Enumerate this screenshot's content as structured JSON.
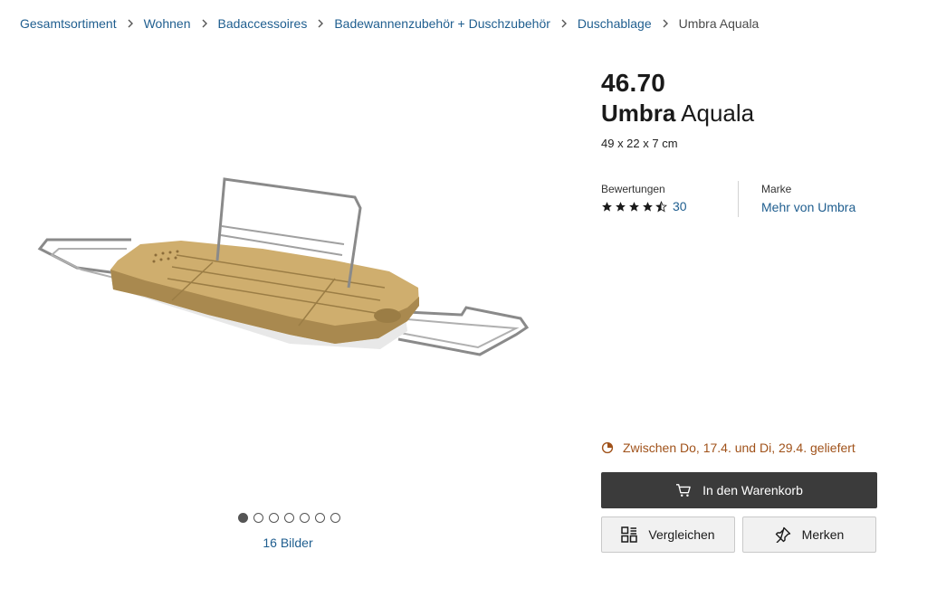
{
  "breadcrumb": {
    "items": [
      "Gesamtsortiment",
      "Wohnen",
      "Badaccessoires",
      "Badewannenzubehör + Duschzubehör",
      "Duschablage"
    ],
    "current": "Umbra Aquala"
  },
  "product": {
    "price": "46.70",
    "brand": "Umbra",
    "model": "Aquala",
    "dimensions": "49 x 22 x 7 cm"
  },
  "ratings": {
    "label": "Bewertungen",
    "stars": 4.5,
    "count": "30"
  },
  "brand_info": {
    "label": "Marke",
    "link": "Mehr von Umbra"
  },
  "gallery": {
    "dots_total": 7,
    "active_index": 0,
    "images_link": "16 Bilder"
  },
  "delivery": {
    "text": "Zwischen Do, 17.4. und Di, 29.4. geliefert",
    "color": "#a0521a"
  },
  "actions": {
    "cart_label": "In den Warenkorb",
    "compare_label": "Vergleichen",
    "save_label": "Merken"
  },
  "colors": {
    "link": "#1f5e8f",
    "primary_button": "#3b3b3b"
  }
}
